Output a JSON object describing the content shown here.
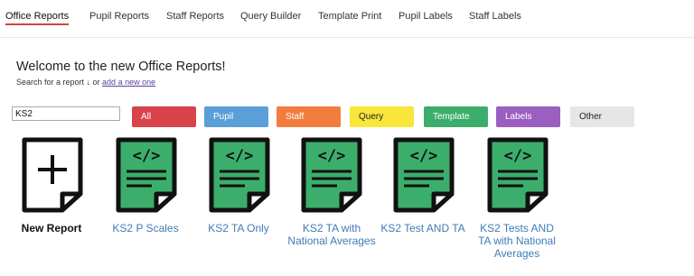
{
  "nav": {
    "tabs": [
      {
        "label": "Office Reports",
        "active": true
      },
      {
        "label": "Pupil Reports"
      },
      {
        "label": "Staff Reports"
      },
      {
        "label": "Query Builder"
      },
      {
        "label": "Template Print"
      },
      {
        "label": "Pupil Labels"
      },
      {
        "label": "Staff Labels"
      }
    ],
    "accent_color": "#d0443f"
  },
  "welcome": {
    "title": "Welcome to the new Office Reports!",
    "sub_prefix": "Search for a report ↓ or ",
    "sub_link": "add a new one"
  },
  "search": {
    "value": "KS2"
  },
  "filters": [
    {
      "label": "All",
      "color": "#d9434b"
    },
    {
      "label": "Pupil",
      "color": "#5a9fd8"
    },
    {
      "label": "Staff",
      "color": "#f27c3c"
    },
    {
      "label": "Query",
      "color": "#f8e63a"
    },
    {
      "label": "Template",
      "color": "#3cae6c"
    },
    {
      "label": "Labels",
      "color": "#9b5fc0"
    },
    {
      "label": "Other",
      "color": "#e6e6e6"
    }
  ],
  "reports": [
    {
      "label": "New Report",
      "icon": "add-document-icon"
    },
    {
      "label": "KS2 P Scales",
      "icon": "code-document-icon"
    },
    {
      "label": "KS2 TA Only",
      "icon": "code-document-icon"
    },
    {
      "label": "KS2 TA with National Averages",
      "icon": "code-document-icon"
    },
    {
      "label": "KS2 Test AND TA",
      "icon": "code-document-icon"
    },
    {
      "label": "KS2 Tests AND TA with National Averages",
      "icon": "code-document-icon"
    }
  ],
  "colors": {
    "template_doc": "#3cae6c",
    "link": "#3f7bb5"
  }
}
